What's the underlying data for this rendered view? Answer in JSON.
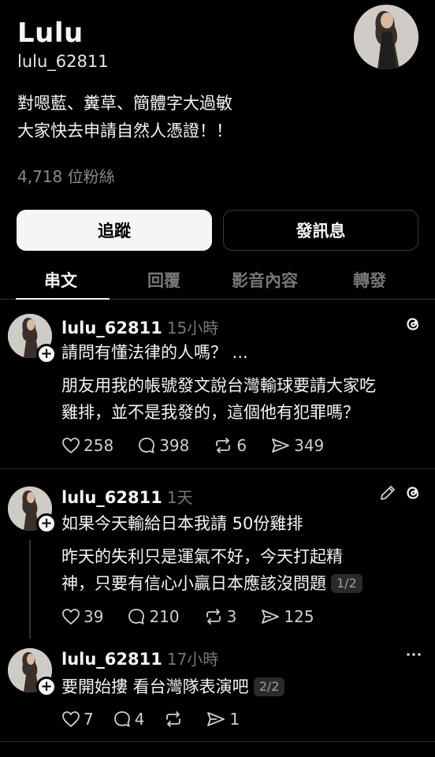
{
  "profile": {
    "name": "Lulu",
    "handle": "lulu_62811",
    "bio_line1": "對嗯藍、糞草、簡體字大過敏",
    "bio_line2": "大家快去申請自然人憑證！！",
    "followers": "4,718 位粉絲"
  },
  "buttons": {
    "follow": "追蹤",
    "message": "發訊息"
  },
  "tabs": [
    "串文",
    "回覆",
    "影音內容",
    "轉發"
  ],
  "posts": [
    {
      "user": "lulu_62811",
      "time": "15小時",
      "line1": "請問有懂法律的人嗎？ ...",
      "line2": "朋友用我的帳號發文說台灣輸球要請大家吃",
      "line3": "雞排，並不是我發的，這個他有犯罪嗎？",
      "likes": "258",
      "comments": "398",
      "reposts": "6",
      "shares": "349"
    },
    {
      "user": "lulu_62811",
      "time": "1天",
      "line1": "如果今天輸給日本我請 50份雞排",
      "line2": "昨天的失利只是運氣不好，今天打起精",
      "line3": "神，只要有信心小贏日本應該沒問題",
      "badge": "1/2",
      "likes": "39",
      "comments": "210",
      "reposts": "3",
      "shares": "125"
    },
    {
      "user": "lulu_62811",
      "time": "17小時",
      "line1": "要開始摟 看台灣隊表演吧",
      "badge": "2/2",
      "likes": "7",
      "comments": "4",
      "reposts": "",
      "shares": "1"
    }
  ],
  "icons": {
    "threads": "threads-logo-icon",
    "edit": "pencil-icon",
    "more": "more-dots-icon",
    "like": "heart-icon",
    "comment": "comment-icon",
    "repost": "repost-icon",
    "share": "send-icon"
  }
}
